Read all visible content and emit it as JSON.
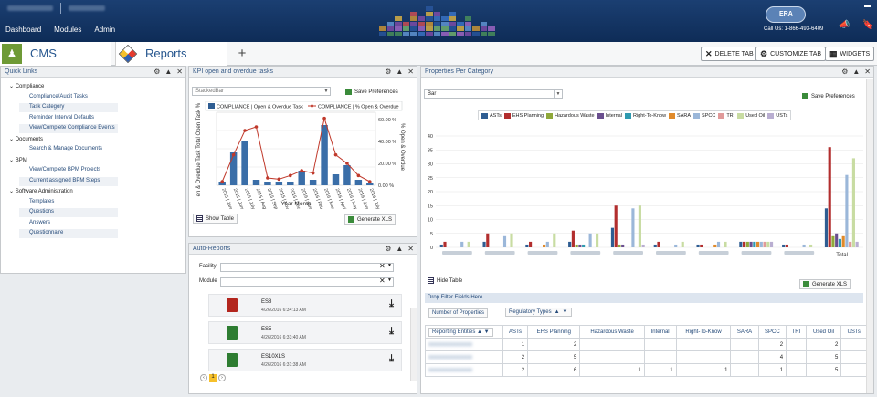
{
  "topbar": {
    "nav": [
      "Dashboard",
      "Modules",
      "Admin"
    ],
    "logo_text": "ERA",
    "phone": "Call Us: 1-866-493-6409"
  },
  "tabs": {
    "cms": "CMS",
    "reports": "Reports",
    "add": "+",
    "delete_tab": "DELETE TAB",
    "customize_tab": "CUSTOMIZE TAB",
    "widgets": "WIDGETS"
  },
  "quick_links": {
    "title": "Quick Links",
    "groups": [
      {
        "label": "Compliance",
        "items": [
          "Compliance/Audit Tasks",
          "Task Category",
          "Reminder Interval Defaults",
          "View/Complete Compliance Events"
        ]
      },
      {
        "label": "Documents",
        "items": [
          "Search & Manage Documents"
        ]
      },
      {
        "label": "BPM",
        "items": [
          "View/Complete BPM Projects",
          "Current assigned BPM Steps"
        ]
      },
      {
        "label": "Software Administration",
        "items": [
          "Templates",
          "Questions",
          "Answers",
          "Questionnaire"
        ]
      }
    ]
  },
  "kpi": {
    "title": "KPI open and overdue tasks",
    "select": "StackedBar",
    "save_prefs": "Save Preferences",
    "legend": [
      "COMPLIANCE | Open & Overdue Task",
      "COMPLIANCE | % Open & Overdue"
    ],
    "ylabel_left": "en & Overdue Task Total Open Task % O",
    "ylabel_right": "% Open & Overdue",
    "xlabel": "Year Month",
    "y2_ticks": [
      "60.00 %",
      "40.00 %",
      "20.00 %",
      "0.00 %"
    ],
    "show_table": "Show Table",
    "generate_xls": "Generate XLS"
  },
  "chart_data": [
    {
      "type": "bar",
      "title": "",
      "xlabel": "Year Month",
      "ylabel": "en & Overdue Task Total Open Task % O",
      "categories": [
        "2015 | January",
        "2015 | June",
        "2015 | July",
        "2015 | August",
        "2015 | September",
        "2015 | November",
        "2015 | December",
        "2016 | January",
        "2016 | February",
        "2016 | March",
        "2016 | April",
        "2016 | May",
        "2016 | June",
        "2016 | July"
      ],
      "series": [
        {
          "name": "COMPLIANCE | Open & Overdue Task",
          "values": [
            2,
            18,
            24,
            3,
            2,
            2,
            2,
            8,
            3,
            33,
            6,
            11,
            3,
            1
          ]
        },
        {
          "name": "COMPLIANCE | % Open & Overdue",
          "values": [
            3,
            25,
            45,
            48,
            6,
            5,
            8,
            12,
            10,
            55,
            25,
            18,
            8,
            3
          ]
        }
      ],
      "y2_ticks": [
        "60.00 %",
        "40.00 %",
        "20.00 %",
        "0.00 %"
      ]
    },
    {
      "type": "bar",
      "title": "",
      "categories": [
        "",
        "",
        "",
        "",
        "",
        "",
        "",
        "",
        "",
        "Total"
      ],
      "y_ticks": [
        "40",
        "35",
        "30",
        "25",
        "20",
        "15",
        "10",
        "5",
        "0"
      ],
      "ylim": [
        0,
        40
      ],
      "series": [
        {
          "name": "ASTs",
          "values": [
            1,
            2,
            1,
            2,
            7,
            1,
            1,
            2,
            1,
            14
          ]
        },
        {
          "name": "EHS Planning",
          "values": [
            2,
            5,
            2,
            6,
            15,
            2,
            1,
            2,
            1,
            36
          ]
        },
        {
          "name": "Hazardous Waste",
          "values": [
            0,
            0,
            0,
            1,
            1,
            0,
            0,
            2,
            0,
            4
          ]
        },
        {
          "name": "Internal",
          "values": [
            0,
            0,
            0,
            1,
            1,
            0,
            0,
            2,
            0,
            5
          ]
        },
        {
          "name": "Right-To-Know",
          "values": [
            0,
            0,
            0,
            1,
            0,
            0,
            0,
            2,
            0,
            3
          ]
        },
        {
          "name": "SARA",
          "values": [
            0,
            0,
            1,
            0,
            0,
            0,
            1,
            2,
            0,
            4
          ]
        },
        {
          "name": "SPCC",
          "values": [
            2,
            4,
            2,
            5,
            14,
            1,
            2,
            2,
            1,
            26
          ]
        },
        {
          "name": "TRI",
          "values": [
            0,
            0,
            0,
            0,
            0,
            0,
            0,
            2,
            0,
            2
          ]
        },
        {
          "name": "Used Oil",
          "values": [
            2,
            5,
            5,
            5,
            15,
            2,
            2,
            2,
            1,
            32
          ]
        },
        {
          "name": "USTs",
          "values": [
            0,
            0,
            0,
            0,
            1,
            0,
            0,
            2,
            0,
            2
          ]
        }
      ]
    }
  ],
  "auto_reports": {
    "title": "Auto-Reports",
    "facility_label": "Facility",
    "module_label": "Module",
    "items": [
      {
        "name": "ES8",
        "date": "4/26/2016 6:34:13 AM",
        "kind": "pdf"
      },
      {
        "name": "ES5",
        "date": "4/26/2016 6:33:40 AM",
        "kind": "xls"
      },
      {
        "name": "ES10XLS",
        "date": "4/26/2016 6:31:38 AM",
        "kind": "xls"
      }
    ],
    "page": "1"
  },
  "properties": {
    "title": "Properties Per Category",
    "select": "Bar",
    "save_prefs": "Save Preferences",
    "legend": [
      "ASTs",
      "EHS Planning",
      "Hazardous Waste",
      "Internal",
      "Right-To-Know",
      "SARA",
      "SPCC",
      "TRI",
      "Used Oil",
      "USTs"
    ],
    "colors": [
      "#2e5d92",
      "#b22e2e",
      "#8fa83a",
      "#6a4f8f",
      "#2f9ab0",
      "#e08a2a",
      "#9bb7d9",
      "#e09a9a",
      "#c8dca2",
      "#b9aed1"
    ],
    "hide_table": "Hide Table",
    "generate_xls": "Generate XLS",
    "drop_filter": "Drop Filter Fields Here",
    "number_of_properties": "Number of Properties",
    "regulatory_types": "Regulatory Types",
    "reporting_entities": "Reporting Entities",
    "columns": [
      "ASTs",
      "EHS Planning",
      "Hazardous Waste",
      "Internal",
      "Right-To-Know",
      "SARA",
      "SPCC",
      "TRI",
      "Used Oil",
      "USTs"
    ],
    "rows": [
      [
        "1",
        "2",
        "",
        "",
        "",
        "",
        "2",
        "",
        "2",
        ""
      ],
      [
        "2",
        "5",
        "",
        "",
        "",
        "",
        "4",
        "",
        "5",
        ""
      ],
      [
        "2",
        "6",
        "1",
        "1",
        "1",
        "",
        "1",
        "",
        "5",
        ""
      ]
    ],
    "total_label": "Total"
  }
}
